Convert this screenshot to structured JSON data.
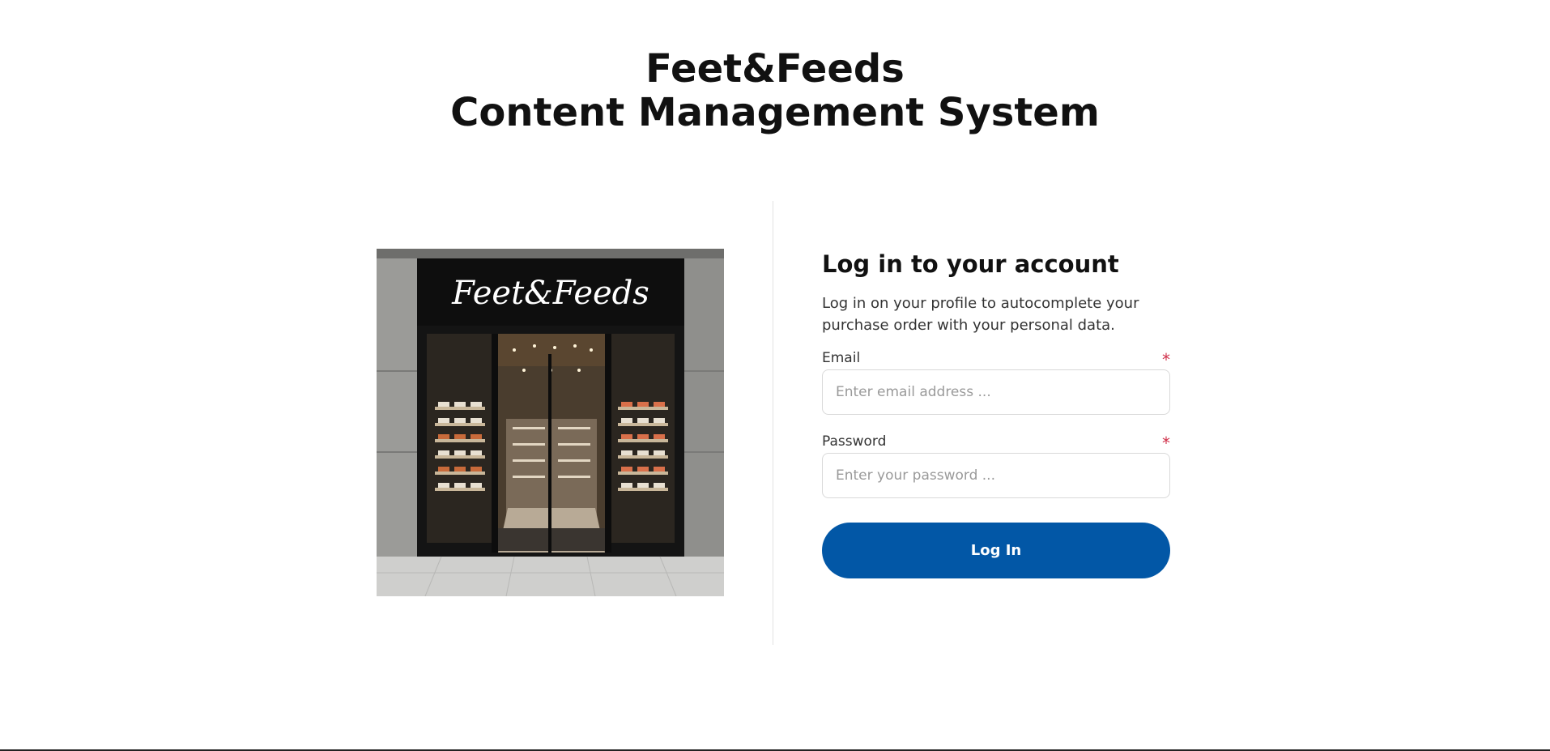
{
  "header": {
    "title_line1": "Feet&Feeds",
    "title_line2": "Content Management System"
  },
  "image": {
    "sign_text": "Feet&Feeds",
    "name": "storefront-image"
  },
  "login": {
    "heading": "Log in to your account",
    "description": "Log in on your profile to autocomplete your purchase order with your personal data.",
    "email": {
      "label": "Email",
      "placeholder": "Enter email address ...",
      "value": "",
      "required_mark": "*"
    },
    "password": {
      "label": "Password",
      "placeholder": "Enter your password ...",
      "value": "",
      "required_mark": "*"
    },
    "submit_label": "Log In"
  },
  "colors": {
    "primary_button": "#0257a6",
    "required": "#d0304a",
    "divider": "#e3e3e3"
  }
}
